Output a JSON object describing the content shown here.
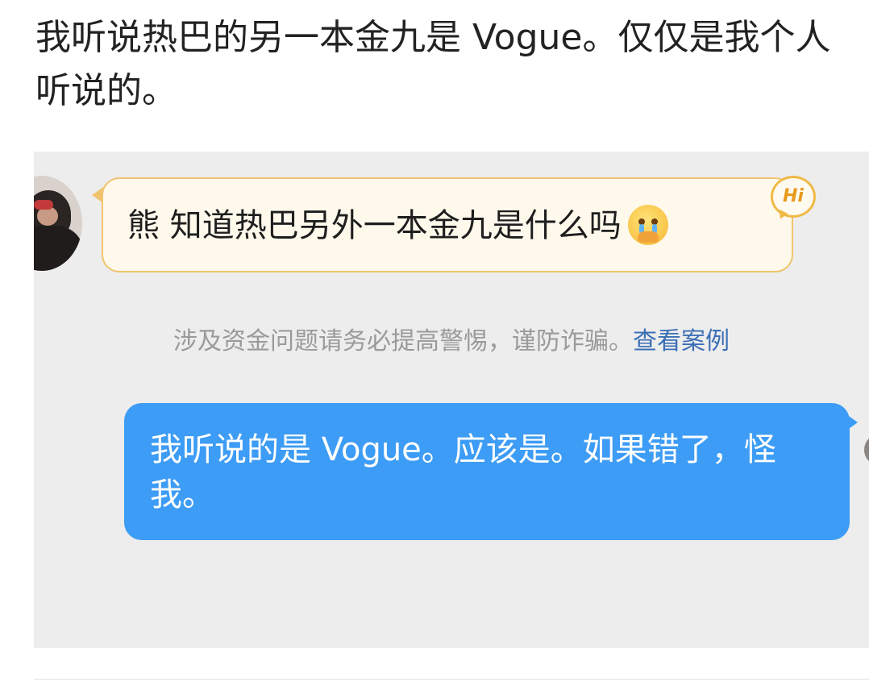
{
  "post": {
    "line1": "我听说热巴的另一本金九是 Vogue。仅仅是我个人",
    "line2": "听说的。"
  },
  "chat": {
    "incoming_message": "熊 知道热巴另外一本金九是什么吗",
    "incoming_emoji": "pleading-crying-face",
    "hi_badge": "Hi",
    "notice_text": "涉及资金问题请务必提高警惕，谨防诈骗。",
    "notice_link": "查看案例",
    "outgoing_message": "我听说的是 Vogue。应该是。如果错了，怪我。",
    "colors": {
      "outgoing_bubble": "#3d9cf5",
      "incoming_bubble": "#fff9ec",
      "incoming_border": "#f0c46e",
      "panel_background": "#ededed",
      "link": "#3b6fb6"
    }
  }
}
